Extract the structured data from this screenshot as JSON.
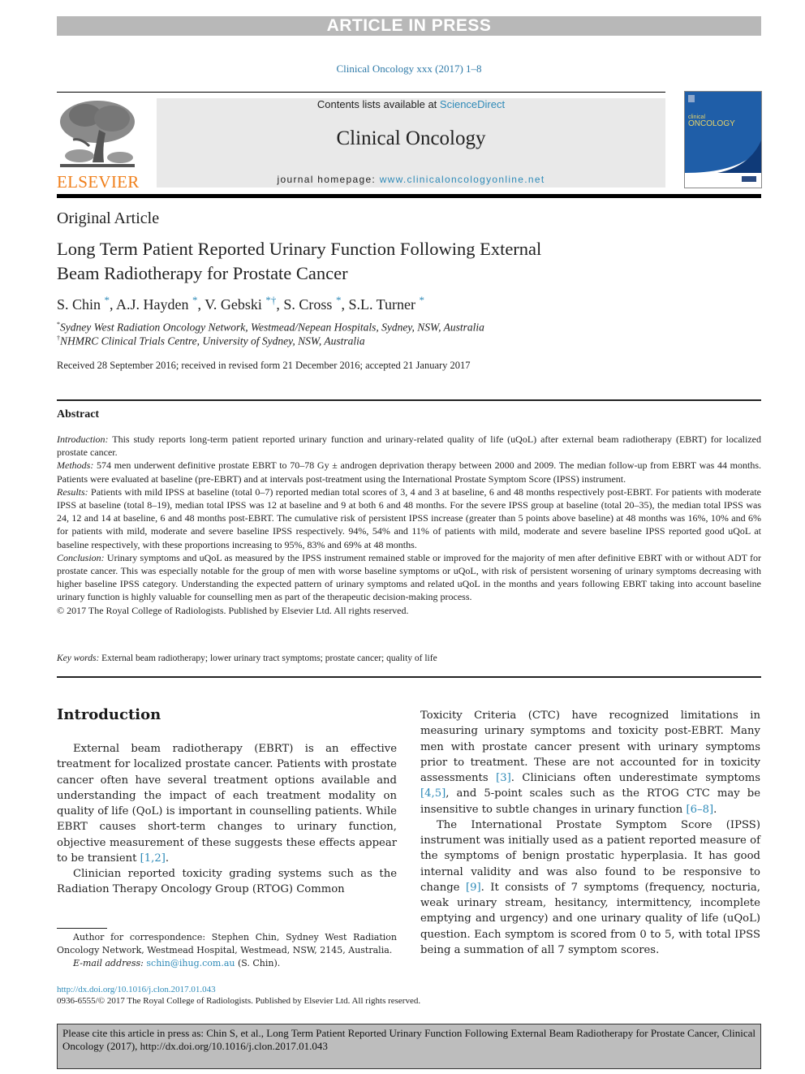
{
  "banner": "ARTICLE IN PRESS",
  "journal_ref": "Clinical Oncology xxx (2017) 1–8",
  "masthead": {
    "contents_prefix": "Contents lists available at ",
    "contents_link": "ScienceDirect",
    "journal_name": "Clinical Oncology",
    "homepage_prefix": "journal homepage: ",
    "homepage_link": "www.clinicaloncologyonline.net",
    "publisher_logo_text": "ELSEVIER",
    "cover_title_small": "clinical",
    "cover_title_big": "ONCOLOGY",
    "brand_color": "#f07f1a",
    "link_color": "#2e8ab8"
  },
  "article": {
    "type": "Original Article",
    "title_line1": "Long Term Patient Reported Urinary Function Following External",
    "title_line2": "Beam Radiotherapy for Prostate Cancer",
    "authors": [
      {
        "name": "S. Chin",
        "marks": "*"
      },
      {
        "name": "A.J. Hayden",
        "marks": "*"
      },
      {
        "name": "V. Gebski",
        "marks": "*†"
      },
      {
        "name": "S. Cross",
        "marks": "*"
      },
      {
        "name": "S.L. Turner",
        "marks": "*"
      }
    ],
    "affiliations": [
      {
        "mark": "*",
        "text": "Sydney West Radiation Oncology Network, Westmead/Nepean Hospitals, Sydney, NSW, Australia"
      },
      {
        "mark": "†",
        "text": "NHMRC Clinical Trials Centre, University of Sydney, NSW, Australia"
      }
    ],
    "dates": "Received 28 September 2016; received in revised form 21 December 2016; accepted 21 January 2017"
  },
  "abstract": {
    "heading": "Abstract",
    "sections": [
      {
        "label": "Introduction:",
        "text": " This study reports long-term patient reported urinary function and urinary-related quality of life (uQoL) after external beam radiotherapy (EBRT) for localized prostate cancer."
      },
      {
        "label": "Methods:",
        "text": " 574 men underwent definitive prostate EBRT to 70–78 Gy ± androgen deprivation therapy between 2000 and 2009. The median follow-up from EBRT was 44 months. Patients were evaluated at baseline (pre-EBRT) and at intervals post-treatment using the International Prostate Symptom Score (IPSS) instrument."
      },
      {
        "label": "Results:",
        "text": " Patients with mild IPSS at baseline (total 0–7) reported median total scores of 3, 4 and 3 at baseline, 6 and 48 months respectively post-EBRT. For patients with moderate IPSS at baseline (total 8–19), median total IPSS was 12 at baseline and 9 at both 6 and 48 months. For the severe IPSS group at baseline (total 20–35), the median total IPSS was 24, 12 and 14 at baseline, 6 and 48 months post-EBRT. The cumulative risk of persistent IPSS increase (greater than 5 points above baseline) at 48 months was 16%, 10% and 6% for patients with mild, moderate and severe baseline IPSS respectively. 94%, 54% and 11% of patients with mild, moderate and severe baseline IPSS reported good uQoL at baseline respectively, with these proportions increasing to 95%, 83% and 69% at 48 months."
      },
      {
        "label": "Conclusion:",
        "text": " Urinary symptoms and uQoL as measured by the IPSS instrument remained stable or improved for the majority of men after definitive EBRT with or without ADT for prostate cancer. This was especially notable for the group of men with worse baseline symptoms or uQoL, with risk of persistent worsening of urinary symptoms decreasing with higher baseline IPSS category. Understanding the expected pattern of urinary symptoms and related uQoL in the months and years following EBRT taking into account baseline urinary function is highly valuable for counselling men as part of the therapeutic decision-making process."
      }
    ],
    "copyright": "© 2017 The Royal College of Radiologists. Published by Elsevier Ltd. All rights reserved."
  },
  "keywords": {
    "label": "Key words:",
    "text": " External beam radiotherapy; lower urinary tract symptoms; prostate cancer; quality of life"
  },
  "body": {
    "intro_heading": "Introduction",
    "left_p1_a": "External beam radiotherapy (EBRT) is an effective treatment for localized prostate cancer. Patients with prostate cancer often have several treatment options available and understanding the impact of each treatment modality on quality of life (QoL) is important in counselling patients. While EBRT causes short-term changes to urinary function, objective measurement of these suggests these effects appear to be transient ",
    "left_p1_ref": "[1,2]",
    "left_p1_b": ".",
    "left_p2": "Clinician reported toxicity grading systems such as the Radiation Therapy Oncology Group (RTOG) Common",
    "right_p1_a": "Toxicity Criteria (CTC) have recognized limitations in measuring urinary symptoms and toxicity post-EBRT. Many men with prostate cancer present with urinary symptoms prior to treatment. These are not accounted for in toxicity assessments ",
    "right_p1_ref1": "[3]",
    "right_p1_b": ". Clinicians often underestimate symptoms ",
    "right_p1_ref2": "[4,5]",
    "right_p1_c": ", and 5-point scales such as the RTOG CTC may be insensitive to subtle changes in urinary function ",
    "right_p1_ref3": "[6–8]",
    "right_p1_d": ".",
    "right_p2_a": "The International Prostate Symptom Score (IPSS) instrument was initially used as a patient reported measure of the symptoms of benign prostatic hyperplasia. It has good internal validity and was also found to be responsive to change ",
    "right_p2_ref": "[9]",
    "right_p2_b": ". It consists of 7 symptoms (frequency, nocturia, weak urinary stream, hesitancy, intermittency, incomplete emptying and urgency) and one urinary quality of life (uQoL) question. Each symptom is scored from 0 to 5, with total IPSS being a summation of all 7 symptom scores."
  },
  "footnote": {
    "correspondence": "Author for correspondence: Stephen Chin, Sydney West Radiation Oncology Network, Westmead Hospital, Westmead, NSW, 2145, Australia.",
    "email_label": "E-mail address:",
    "email": "schin@ihug.com.au",
    "email_suffix": " (S. Chin)."
  },
  "footer": {
    "doi": "http://dx.doi.org/10.1016/j.clon.2017.01.043",
    "copyright": "0936-6555/© 2017 The Royal College of Radiologists. Published by Elsevier Ltd. All rights reserved.",
    "cite": "Please cite this article in press as: Chin S, et al., Long Term Patient Reported Urinary Function Following External Beam Radiotherapy for Prostate Cancer, Clinical Oncology (2017), http://dx.doi.org/10.1016/j.clon.2017.01.043"
  }
}
